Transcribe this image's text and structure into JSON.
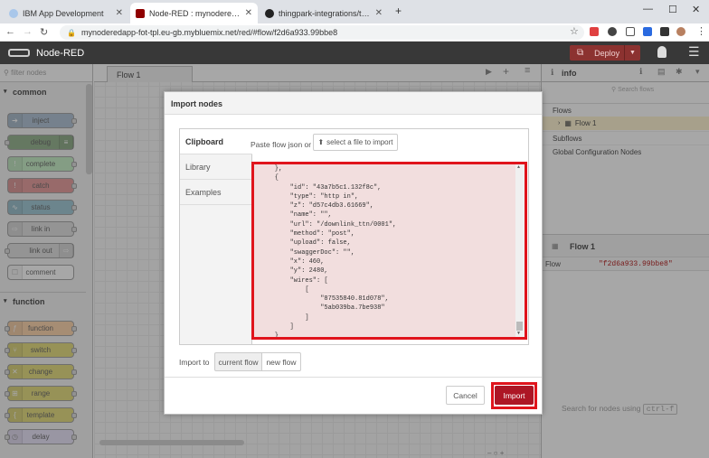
{
  "browser": {
    "tabs": [
      {
        "title": "IBM App Development"
      },
      {
        "title": "Node-RED : mynoderedapp-fot-"
      },
      {
        "title": "thingpark-integrations/ttn-rest-"
      }
    ],
    "url": "mynoderedapp-fot-tpl.eu-gb.mybluemix.net/red/#flow/f2d6a933.99bbe8"
  },
  "app": {
    "title": "Node-RED",
    "deploy_label": "Deploy"
  },
  "palette": {
    "filter_placeholder": "filter nodes",
    "categories": [
      {
        "name": "common",
        "nodes": [
          "inject",
          "debug",
          "complete",
          "catch",
          "status",
          "link in",
          "link out",
          "comment"
        ]
      },
      {
        "name": "function",
        "nodes": [
          "function",
          "switch",
          "change",
          "range",
          "template",
          "delay"
        ]
      }
    ]
  },
  "workspace": {
    "flow_tab": "Flow 1"
  },
  "sidebar": {
    "title": "info",
    "search_placeholder": "Search flows",
    "tree": [
      "Flows",
      "Flow 1",
      "Subflows",
      "Global Configuration Nodes"
    ],
    "info_title": "Flow 1",
    "info_key": "Flow",
    "info_value": "\"f2d6a933.99bbe8\"",
    "hint": "Search for nodes using",
    "hint_key": "ctrl-f"
  },
  "dialog": {
    "title": "Import nodes",
    "tabs": [
      "Clipboard",
      "Library",
      "Examples"
    ],
    "paste_label": "Paste flow json or",
    "select_file_label": "select a file to import",
    "json_text": "    },\n    {\n        \"id\": \"43a7b5c1.132f8c\",\n        \"type\": \"http in\",\n        \"z\": \"d57c4db3.61669\",\n        \"name\": \"\",\n        \"url\": \"/downlink_ttn/0001\",\n        \"method\": \"post\",\n        \"upload\": false,\n        \"swaggerDoc\": \"\",\n        \"x\": 460,\n        \"y\": 2480,\n        \"wires\": [\n            [\n                \"87535840.81d078\",\n                \"5ab039ba.7be938\"\n            ]\n        ]\n    }\n]",
    "import_to_label": "Import to",
    "import_to_options": [
      "current flow",
      "new flow"
    ],
    "cancel_label": "Cancel",
    "import_label": "Import"
  },
  "colors": {
    "deploy": "#8c3230",
    "highlight": "#e0141c",
    "import_button": "#ad1625"
  }
}
